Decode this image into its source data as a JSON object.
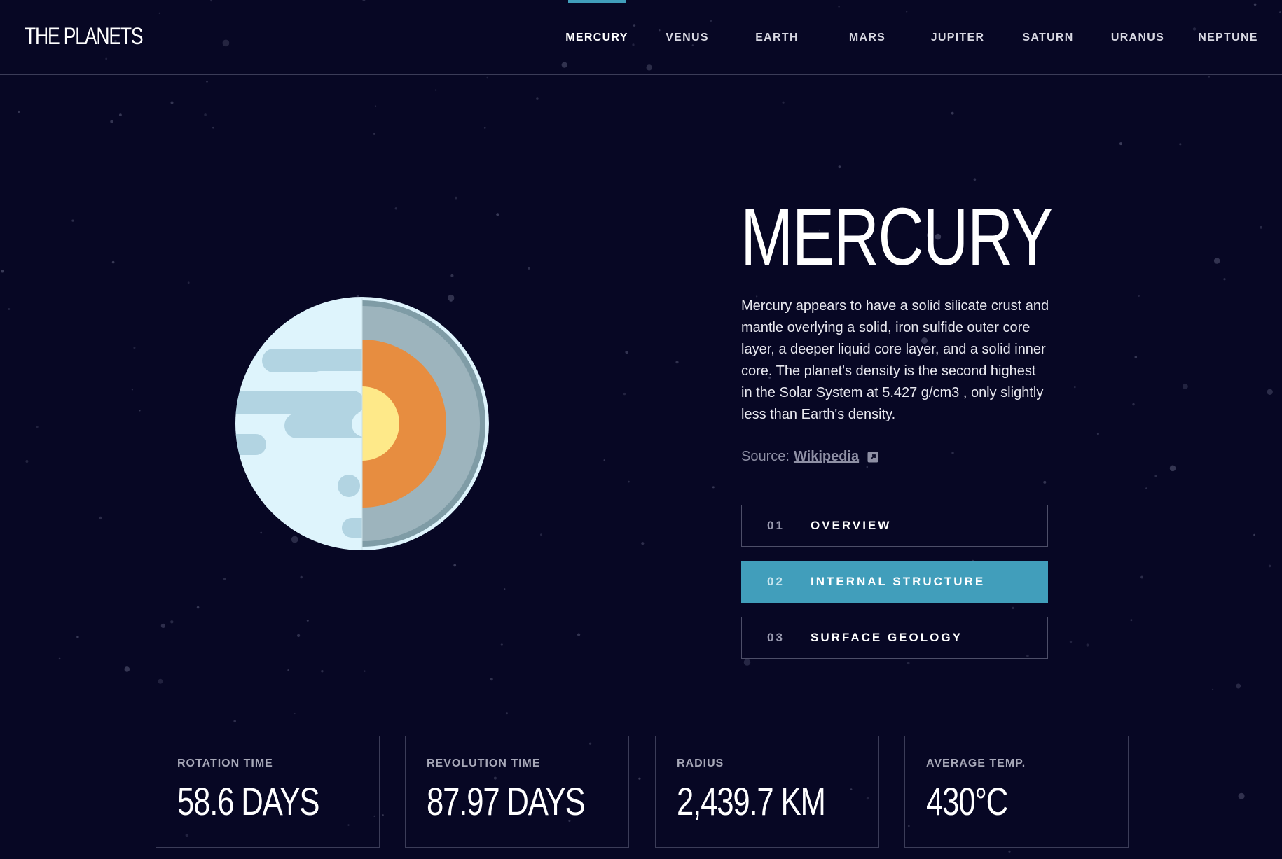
{
  "site": {
    "logo": "THE PLANETS"
  },
  "nav": {
    "items": [
      "MERCURY",
      "VENUS",
      "EARTH",
      "MARS",
      "JUPITER",
      "SATURN",
      "URANUS",
      "NEPTUNE"
    ],
    "active": "MERCURY"
  },
  "planet": {
    "name": "MERCURY",
    "description": "Mercury appears to have a solid silicate crust and mantle overlying a solid, iron sulfide outer core layer, a deeper liquid core layer, and a solid inner core. The planet's density is the second highest in the Solar System at 5.427 g/cm3 , only slightly less than Earth's density.",
    "source_prefix": "Source:",
    "source_link": "Wikipedia"
  },
  "tabs": [
    {
      "num": "01",
      "label": "OVERVIEW",
      "active": false
    },
    {
      "num": "02",
      "label": "INTERNAL STRUCTURE",
      "active": true
    },
    {
      "num": "03",
      "label": "SURFACE GEOLOGY",
      "active": false
    }
  ],
  "stats": [
    {
      "label": "ROTATION TIME",
      "value": "58.6 DAYS"
    },
    {
      "label": "REVOLUTION TIME",
      "value": "87.97 DAYS"
    },
    {
      "label": "RADIUS",
      "value": "2,439.7 KM"
    },
    {
      "label": "AVERAGE TEMP.",
      "value": "430°C"
    }
  ],
  "colors": {
    "background": "#070724",
    "accent": "#419ebb",
    "planet_surface": "#def4fc",
    "planet_surface_dark": "#b2d4e2",
    "mantle": "#9db4bd",
    "outer_core": "#e78d40",
    "inner_core": "#fee989"
  },
  "icons": {
    "external_link": "external-link-icon"
  }
}
